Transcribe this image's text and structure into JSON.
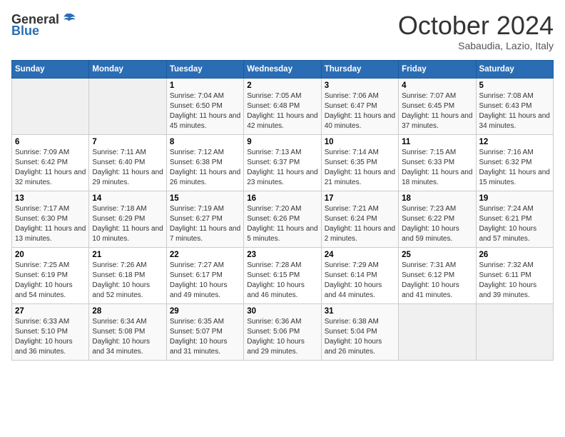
{
  "header": {
    "logo_general": "General",
    "logo_blue": "Blue",
    "month_title": "October 2024",
    "location": "Sabaudia, Lazio, Italy"
  },
  "days_of_week": [
    "Sunday",
    "Monday",
    "Tuesday",
    "Wednesday",
    "Thursday",
    "Friday",
    "Saturday"
  ],
  "weeks": [
    [
      {
        "empty": true
      },
      {
        "empty": true
      },
      {
        "day": 1,
        "sunrise": "7:04 AM",
        "sunset": "6:50 PM",
        "daylight": "11 hours and 45 minutes."
      },
      {
        "day": 2,
        "sunrise": "7:05 AM",
        "sunset": "6:48 PM",
        "daylight": "11 hours and 42 minutes."
      },
      {
        "day": 3,
        "sunrise": "7:06 AM",
        "sunset": "6:47 PM",
        "daylight": "11 hours and 40 minutes."
      },
      {
        "day": 4,
        "sunrise": "7:07 AM",
        "sunset": "6:45 PM",
        "daylight": "11 hours and 37 minutes."
      },
      {
        "day": 5,
        "sunrise": "7:08 AM",
        "sunset": "6:43 PM",
        "daylight": "11 hours and 34 minutes."
      }
    ],
    [
      {
        "day": 6,
        "sunrise": "7:09 AM",
        "sunset": "6:42 PM",
        "daylight": "11 hours and 32 minutes."
      },
      {
        "day": 7,
        "sunrise": "7:11 AM",
        "sunset": "6:40 PM",
        "daylight": "11 hours and 29 minutes."
      },
      {
        "day": 8,
        "sunrise": "7:12 AM",
        "sunset": "6:38 PM",
        "daylight": "11 hours and 26 minutes."
      },
      {
        "day": 9,
        "sunrise": "7:13 AM",
        "sunset": "6:37 PM",
        "daylight": "11 hours and 23 minutes."
      },
      {
        "day": 10,
        "sunrise": "7:14 AM",
        "sunset": "6:35 PM",
        "daylight": "11 hours and 21 minutes."
      },
      {
        "day": 11,
        "sunrise": "7:15 AM",
        "sunset": "6:33 PM",
        "daylight": "11 hours and 18 minutes."
      },
      {
        "day": 12,
        "sunrise": "7:16 AM",
        "sunset": "6:32 PM",
        "daylight": "11 hours and 15 minutes."
      }
    ],
    [
      {
        "day": 13,
        "sunrise": "7:17 AM",
        "sunset": "6:30 PM",
        "daylight": "11 hours and 13 minutes."
      },
      {
        "day": 14,
        "sunrise": "7:18 AM",
        "sunset": "6:29 PM",
        "daylight": "11 hours and 10 minutes."
      },
      {
        "day": 15,
        "sunrise": "7:19 AM",
        "sunset": "6:27 PM",
        "daylight": "11 hours and 7 minutes."
      },
      {
        "day": 16,
        "sunrise": "7:20 AM",
        "sunset": "6:26 PM",
        "daylight": "11 hours and 5 minutes."
      },
      {
        "day": 17,
        "sunrise": "7:21 AM",
        "sunset": "6:24 PM",
        "daylight": "11 hours and 2 minutes."
      },
      {
        "day": 18,
        "sunrise": "7:23 AM",
        "sunset": "6:22 PM",
        "daylight": "10 hours and 59 minutes."
      },
      {
        "day": 19,
        "sunrise": "7:24 AM",
        "sunset": "6:21 PM",
        "daylight": "10 hours and 57 minutes."
      }
    ],
    [
      {
        "day": 20,
        "sunrise": "7:25 AM",
        "sunset": "6:19 PM",
        "daylight": "10 hours and 54 minutes."
      },
      {
        "day": 21,
        "sunrise": "7:26 AM",
        "sunset": "6:18 PM",
        "daylight": "10 hours and 52 minutes."
      },
      {
        "day": 22,
        "sunrise": "7:27 AM",
        "sunset": "6:17 PM",
        "daylight": "10 hours and 49 minutes."
      },
      {
        "day": 23,
        "sunrise": "7:28 AM",
        "sunset": "6:15 PM",
        "daylight": "10 hours and 46 minutes."
      },
      {
        "day": 24,
        "sunrise": "7:29 AM",
        "sunset": "6:14 PM",
        "daylight": "10 hours and 44 minutes."
      },
      {
        "day": 25,
        "sunrise": "7:31 AM",
        "sunset": "6:12 PM",
        "daylight": "10 hours and 41 minutes."
      },
      {
        "day": 26,
        "sunrise": "7:32 AM",
        "sunset": "6:11 PM",
        "daylight": "10 hours and 39 minutes."
      }
    ],
    [
      {
        "day": 27,
        "sunrise": "6:33 AM",
        "sunset": "5:10 PM",
        "daylight": "10 hours and 36 minutes."
      },
      {
        "day": 28,
        "sunrise": "6:34 AM",
        "sunset": "5:08 PM",
        "daylight": "10 hours and 34 minutes."
      },
      {
        "day": 29,
        "sunrise": "6:35 AM",
        "sunset": "5:07 PM",
        "daylight": "10 hours and 31 minutes."
      },
      {
        "day": 30,
        "sunrise": "6:36 AM",
        "sunset": "5:06 PM",
        "daylight": "10 hours and 29 minutes."
      },
      {
        "day": 31,
        "sunrise": "6:38 AM",
        "sunset": "5:04 PM",
        "daylight": "10 hours and 26 minutes."
      },
      {
        "empty": true
      },
      {
        "empty": true
      }
    ]
  ],
  "labels": {
    "sunrise": "Sunrise:",
    "sunset": "Sunset:",
    "daylight": "Daylight:"
  }
}
